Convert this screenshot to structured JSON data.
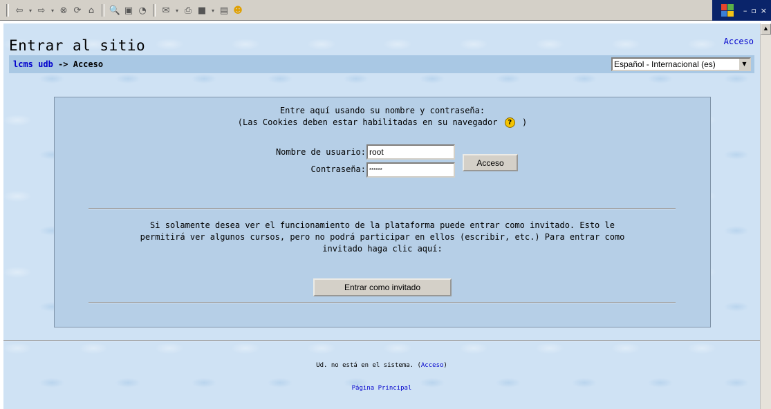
{
  "toolbar": {
    "icons": [
      "back-icon",
      "forward-icon",
      "stop-icon",
      "refresh-icon",
      "home-icon",
      "search-icon",
      "favorites-icon",
      "history-icon",
      "mail-icon",
      "print-icon",
      "edit-icon",
      "discuss-icon",
      "messenger-icon"
    ],
    "glyphs": {
      "back": "⇦",
      "drop": "▾",
      "forward": "⇨",
      "stop": "⊗",
      "refresh": "⟳",
      "home": "⌂",
      "search": "🔍",
      "favorites": "▣",
      "history": "◔",
      "mail": "✉",
      "print": "⎙",
      "edit": "■",
      "discuss": "▤",
      "messenger": "☻"
    },
    "window_controls": {
      "minimize": "–",
      "restore": "▫",
      "close": "×"
    }
  },
  "header": {
    "title": "Entrar al sitio",
    "login_link": "Acceso"
  },
  "navbar": {
    "breadcrumb_home": "lcms udb",
    "breadcrumb_separator": "->",
    "breadcrumb_current": "Acceso",
    "language_selected": "Español - Internacional (es)",
    "language_arrow": "▼"
  },
  "login": {
    "intro_line1": "Entre aquí usando su nombre y contraseña:",
    "intro_line2_before": "(Las Cookies deben estar habilitadas en su navegador",
    "help_icon_glyph": "?",
    "intro_line2_after": ")",
    "username_label": "Nombre de usuario:",
    "username_value": "root",
    "password_label": "Contraseña:",
    "password_value": "******",
    "submit_label": "Acceso"
  },
  "guest": {
    "line1": "Si solamente desea ver el funcionamiento de la plataforma puede entrar como invitado. Esto le",
    "line2": "permitirá ver algunos cursos, pero no podrá participar en ellos (escribir, etc.) Para entrar como",
    "line3": "invitado haga clic aquí:",
    "button_label": "Entrar como invitado"
  },
  "footer": {
    "status_text": "Ud. no está en el sistema. (",
    "status_link": "Acceso",
    "status_close": ")",
    "home_link": "Página Principal"
  },
  "scrollbar": {
    "up_arrow": "▲"
  },
  "colors": {
    "page_bg": "#cfe2f4",
    "navbar_bg": "#a9c8e4",
    "box_bg": "#b6cfe7",
    "link": "#0000cc",
    "titlebar": "#0a246a"
  }
}
